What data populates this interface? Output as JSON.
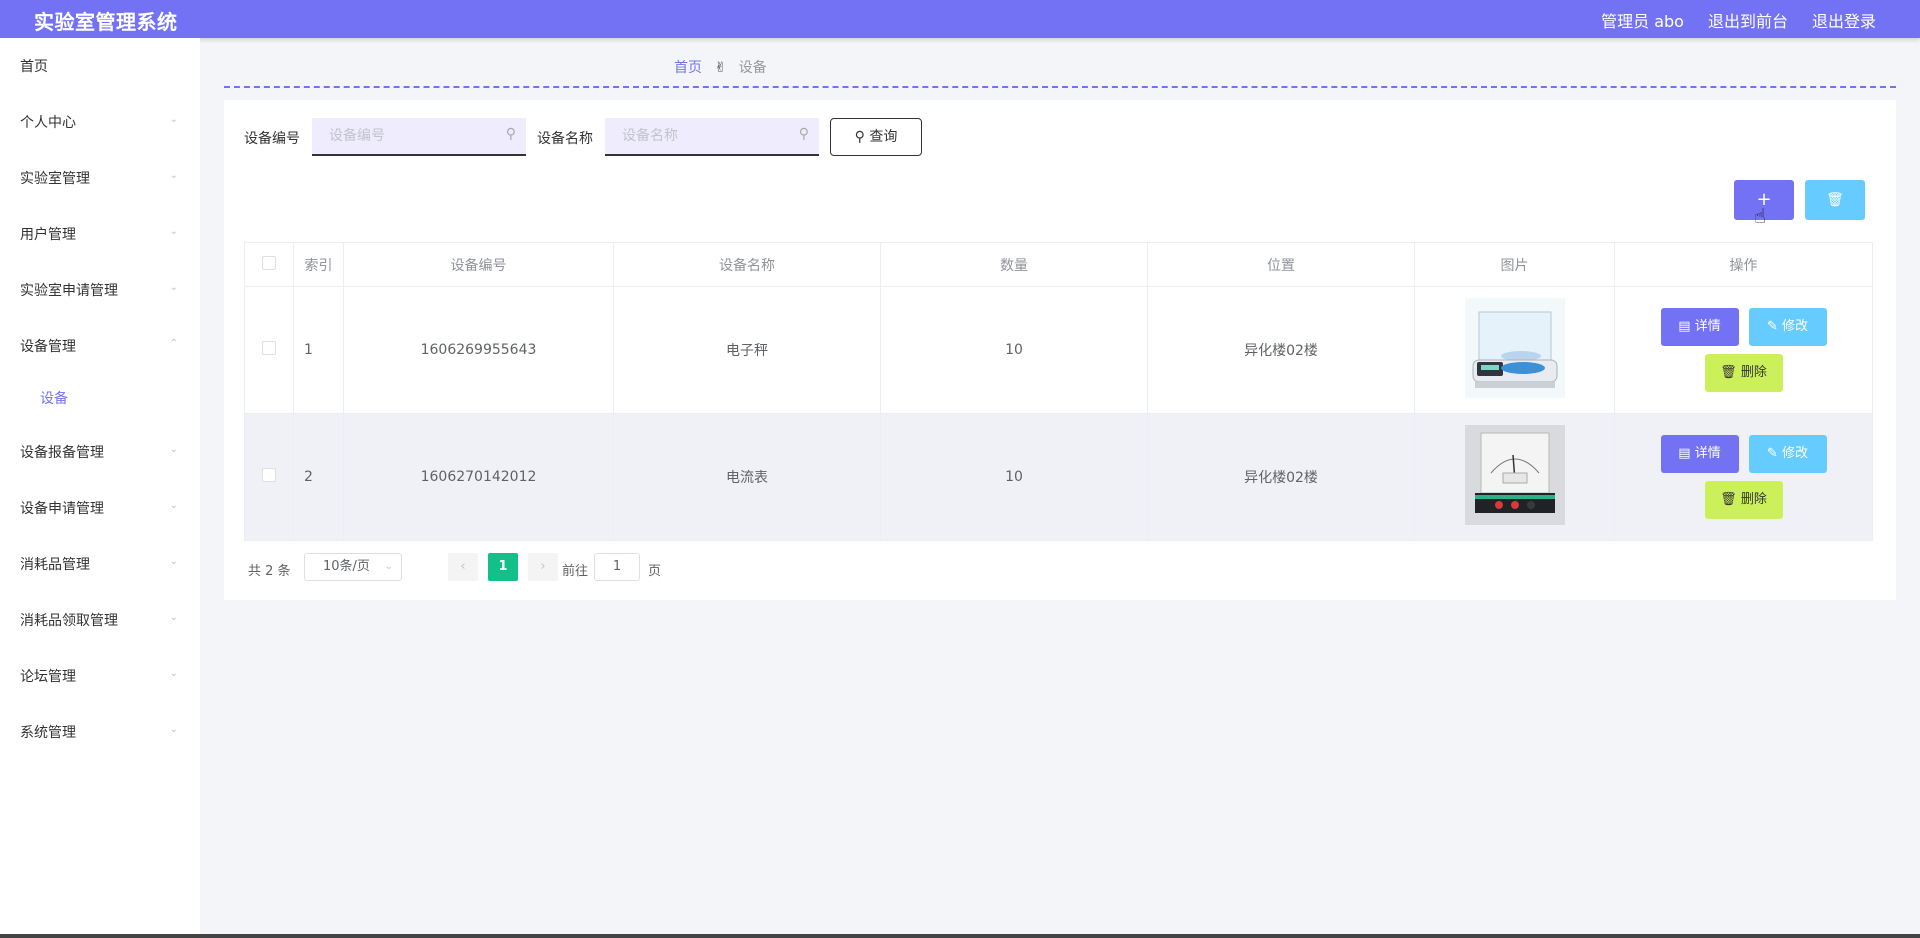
{
  "header": {
    "app_title": "实验室管理系统",
    "user": "管理员 abo",
    "to_front": "退出到前台",
    "logout": "退出登录"
  },
  "sidebar": {
    "items": [
      {
        "label": "首页"
      },
      {
        "label": "个人中心"
      },
      {
        "label": "实验室管理"
      },
      {
        "label": "用户管理"
      },
      {
        "label": "实验室申请管理"
      },
      {
        "label": "设备管理"
      },
      {
        "label": "设备"
      },
      {
        "label": "设备报备管理"
      },
      {
        "label": "设备申请管理"
      },
      {
        "label": "消耗品管理"
      },
      {
        "label": "消耗品领取管理"
      },
      {
        "label": "论坛管理"
      },
      {
        "label": "系统管理"
      }
    ]
  },
  "breadcrumb": {
    "home": "首页",
    "current": "设备"
  },
  "search": {
    "code_label": "设备编号",
    "code_placeholder": "设备编号",
    "name_label": "设备名称",
    "name_placeholder": "设备名称",
    "query_label": "查询"
  },
  "table": {
    "headers": [
      "索引",
      "设备编号",
      "设备名称",
      "数量",
      "位置",
      "图片",
      "操作"
    ],
    "rows": [
      {
        "index": "1",
        "code": "1606269955643",
        "name": "电子秤",
        "qty": "10",
        "location": "异化楼02楼"
      },
      {
        "index": "2",
        "code": "1606270142012",
        "name": "电流表",
        "qty": "10",
        "location": "异化楼02楼"
      }
    ],
    "actions": {
      "detail": "详情",
      "edit": "修改",
      "delete": "删除"
    }
  },
  "pagination": {
    "total": "共 2 条",
    "page_size": "10条/页",
    "current_page": "1",
    "goto_label": "前往",
    "goto_value": "1",
    "page_suffix": "页"
  },
  "colors": {
    "accent": "#7372f4",
    "edit": "#66ccff",
    "delete": "#ccf059",
    "current_page": "#13c08a"
  },
  "icons": {
    "breadcrumb_separator": "hand-icon",
    "add": "plus-icon",
    "batch_delete": "trash-icon",
    "query": "search-icon"
  }
}
